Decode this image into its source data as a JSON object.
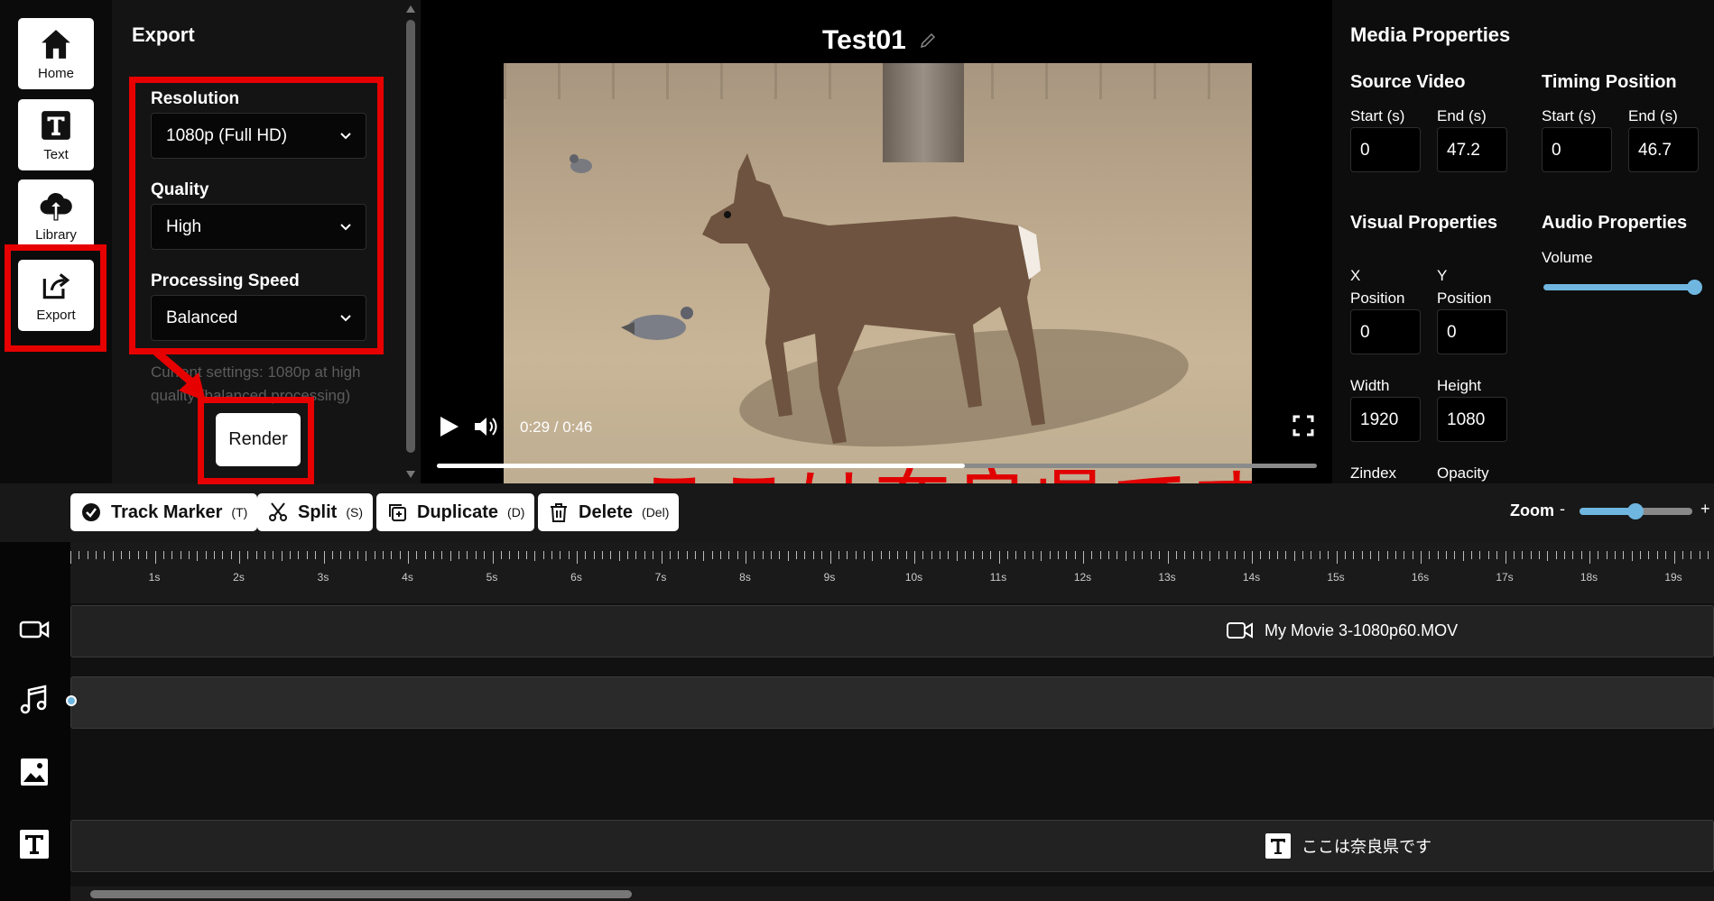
{
  "nav": {
    "home_label": "Home",
    "text_label": "Text",
    "library_label": "Library",
    "export_label": "Export"
  },
  "export_panel": {
    "title": "Export",
    "resolution_label": "Resolution",
    "resolution_value": "1080p (Full HD)",
    "quality_label": "Quality",
    "quality_value": "High",
    "speed_label": "Processing Speed",
    "speed_value": "Balanced",
    "note": "Current settings: 1080p at high quality (balanced processing)",
    "render_label": "Render"
  },
  "preview": {
    "title": "Test01",
    "time": "0:29 / 0:46",
    "progress": 0.6,
    "subtitle": "ここは奈良県です"
  },
  "props": {
    "title": "Media Properties",
    "source_video": "Source Video",
    "timing_position": "Timing Position",
    "start_label": "Start (s)",
    "end_label": "End (s)",
    "source_start": "0",
    "source_end": "47.2",
    "timing_start": "0",
    "timing_end": "46.7",
    "visual_properties": "Visual Properties",
    "audio_properties": "Audio Properties",
    "volume_label": "Volume",
    "x_label_1": "X",
    "x_label_2": "Position",
    "y_label_1": "Y",
    "y_label_2": "Position",
    "x_value": "0",
    "y_value": "0",
    "width_label": "Width",
    "height_label": "Height",
    "width_value": "1920",
    "height_value": "1080",
    "zindex_label": "Zindex",
    "opacity_label": "Opacity"
  },
  "toolbar": {
    "track_marker": "Track Marker",
    "track_marker_key": "(T)",
    "split": "Split",
    "split_key": "(S)",
    "duplicate": "Duplicate",
    "duplicate_key": "(D)",
    "delete": "Delete",
    "delete_key": "(Del)",
    "zoom_label": "Zoom",
    "zoom_minus": "-",
    "zoom_plus": "+"
  },
  "timeline": {
    "ticks": [
      "1s",
      "2s",
      "3s",
      "4s",
      "5s",
      "6s",
      "7s",
      "8s",
      "9s",
      "10s",
      "11s",
      "12s",
      "13s",
      "14s",
      "15s",
      "16s",
      "17s",
      "18s",
      "19s"
    ],
    "video_clip": "My Movie 3-1080p60.MOV",
    "text_clip": "ここは奈良県です"
  },
  "colors": {
    "accent": "#6fb6e0",
    "annotation": "#e60000"
  }
}
